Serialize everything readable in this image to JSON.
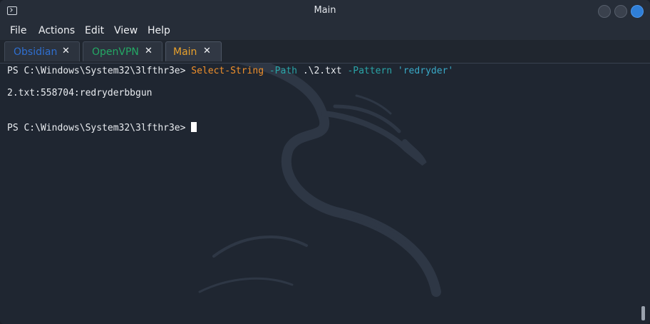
{
  "window": {
    "title": "Main"
  },
  "menu": {
    "items": [
      "File",
      "Actions",
      "Edit",
      "View",
      "Help"
    ]
  },
  "tabs": [
    {
      "label": "Obsidian",
      "color": "#2f6fd0",
      "close": "✕"
    },
    {
      "label": "OpenVPN",
      "color": "#24a865",
      "close": "✕"
    },
    {
      "label": "Main",
      "color": "#e8a12c",
      "close": "✕",
      "active": true
    }
  ],
  "terminal": {
    "line1": {
      "prompt": "PS C:\\Windows\\System32\\3lfthr3e> ",
      "command": "Select-String",
      "param1": "-Path",
      "arg1": " .\\2.txt ",
      "param2": "-Pattern",
      "arg2": "'redryder'"
    },
    "output": "2.txt:558704:redryderbbgun",
    "prompt2": "PS C:\\Windows\\System32\\3lfthr3e> "
  },
  "colors": {
    "command": "#f0902b",
    "parameter": "#2aa5a8",
    "string": "#39a9c7",
    "close_button": "#2f7fd8"
  }
}
